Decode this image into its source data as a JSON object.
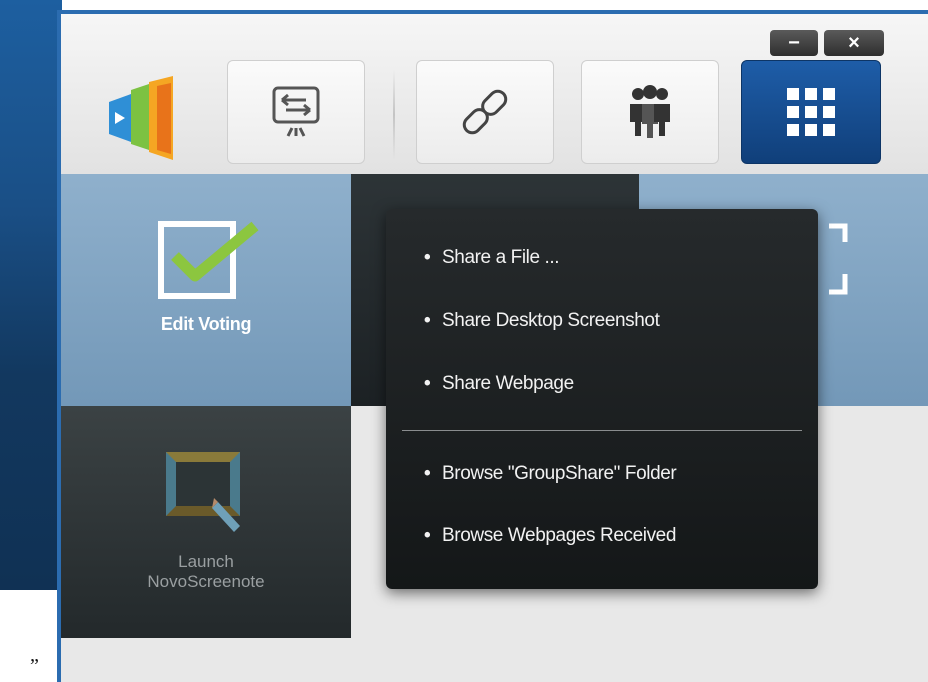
{
  "window": {
    "minimize_glyph": "−",
    "close_glyph": "×"
  },
  "toolbar": {
    "buttons": [
      {
        "icon": "screen-switch-icon"
      },
      {
        "icon": "link-icon"
      },
      {
        "icon": "group-icon"
      },
      {
        "icon": "apps-grid-icon",
        "active": true
      }
    ]
  },
  "tiles": {
    "voting": {
      "label": "Edit Voting",
      "icon": "checkbox-check-icon"
    },
    "launch": {
      "label": "Launch\nNovoScreenote",
      "icon": "screenote-icon"
    }
  },
  "menu": {
    "bullet": "•",
    "items": [
      {
        "label": "Share a File ..."
      },
      {
        "label": "Share Desktop Screenshot"
      },
      {
        "label": "Share Webpage"
      },
      {
        "label": "Browse \"GroupShare\" Folder"
      },
      {
        "label": "Browse Webpages Received"
      }
    ]
  },
  "stray_text": "”",
  "colors": {
    "accent": "#1e5da8",
    "tile_blue": "#7f9fbf",
    "tile_dark": "#23292b",
    "check_green": "#8cc63f"
  }
}
